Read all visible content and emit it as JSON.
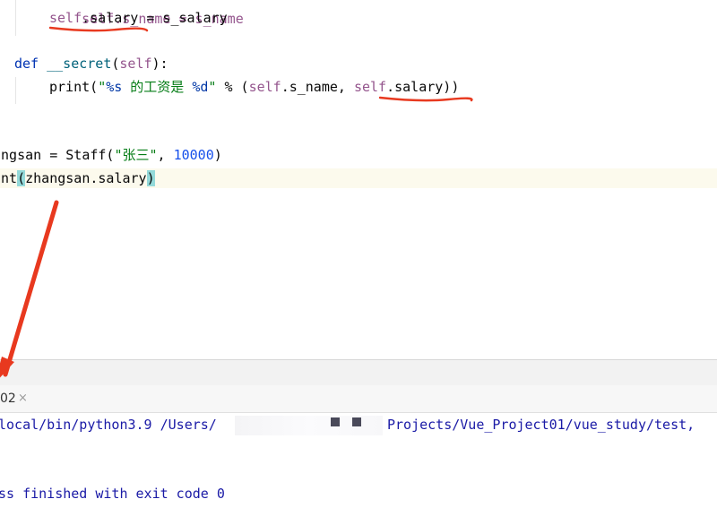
{
  "editor": {
    "line_top_partial": "self.s_name = s_name",
    "line_salary": {
      "self": "self",
      "rest": ".salary = s_salary"
    },
    "line_def": {
      "kw": "def",
      "name": "__secret",
      "lp": "(",
      "self": "self",
      "rp": "):"
    },
    "line_print": {
      "fn": "print(",
      "str_a": "\"",
      "fmt_s": "%s",
      "str_mid": " 的工资是 ",
      "fmt_d": "%d",
      "str_b": "\"",
      "op": " % (",
      "self1": "self",
      "mid": ".s_name, ",
      "self2": "self",
      "end": ".salary))"
    },
    "line_zhangsan": {
      "left": "angsan = Staff(",
      "str": "\"张三\"",
      "comma": ", ",
      "num": "10000",
      "close": ")"
    },
    "line_print2": {
      "left": "int",
      "lp": "(",
      "mid": "zhangsan.salary",
      "rp": ")"
    }
  },
  "run_tab": {
    "label": "02",
    "close_glyph": "×"
  },
  "console": {
    "cmd_left": "local/bin/python3.9 /Users/",
    "cmd_right": "Projects/Vue_Project01/vue_study/test,",
    "exit_msg": "ss finished with exit code 0"
  },
  "colors": {
    "annotation_red": "#e8391f",
    "self_purple": "#94558d",
    "keyword_blue": "#0033b3",
    "string_green": "#067d17"
  }
}
